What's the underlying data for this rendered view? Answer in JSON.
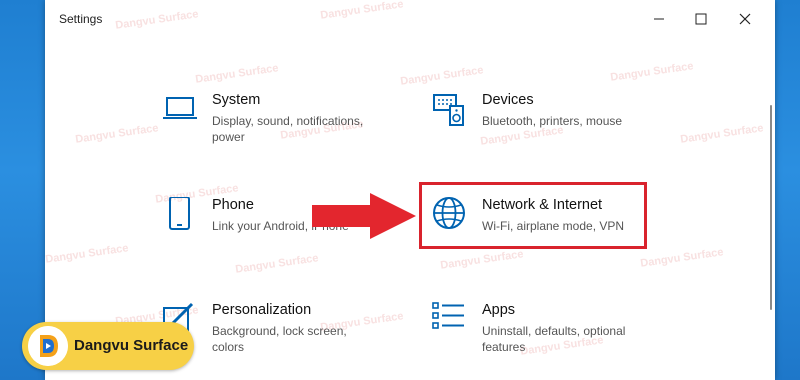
{
  "window": {
    "title": "Settings"
  },
  "watermark": "Dangvu Surface",
  "badge": {
    "text": "Dangvu Surface"
  },
  "tiles": {
    "system": {
      "name": "System",
      "desc": "Display, sound, notifications, power"
    },
    "devices": {
      "name": "Devices",
      "desc": "Bluetooth, printers, mouse"
    },
    "phone": {
      "name": "Phone",
      "desc": "Link your Android, iPhone"
    },
    "network": {
      "name": "Network & Internet",
      "desc": "Wi-Fi, airplane mode, VPN"
    },
    "personalization": {
      "name": "Personalization",
      "desc": "Background, lock screen, colors"
    },
    "apps": {
      "name": "Apps",
      "desc": "Uninstall, defaults, optional features"
    }
  },
  "colors": {
    "accent": "#0063b1",
    "highlight": "#d9232d",
    "badge": "#f7d046"
  },
  "icons": [
    "laptop-icon",
    "keyboard-speaker-icon",
    "phone-icon",
    "globe-icon",
    "pen-tablet-icon",
    "apps-list-icon"
  ]
}
